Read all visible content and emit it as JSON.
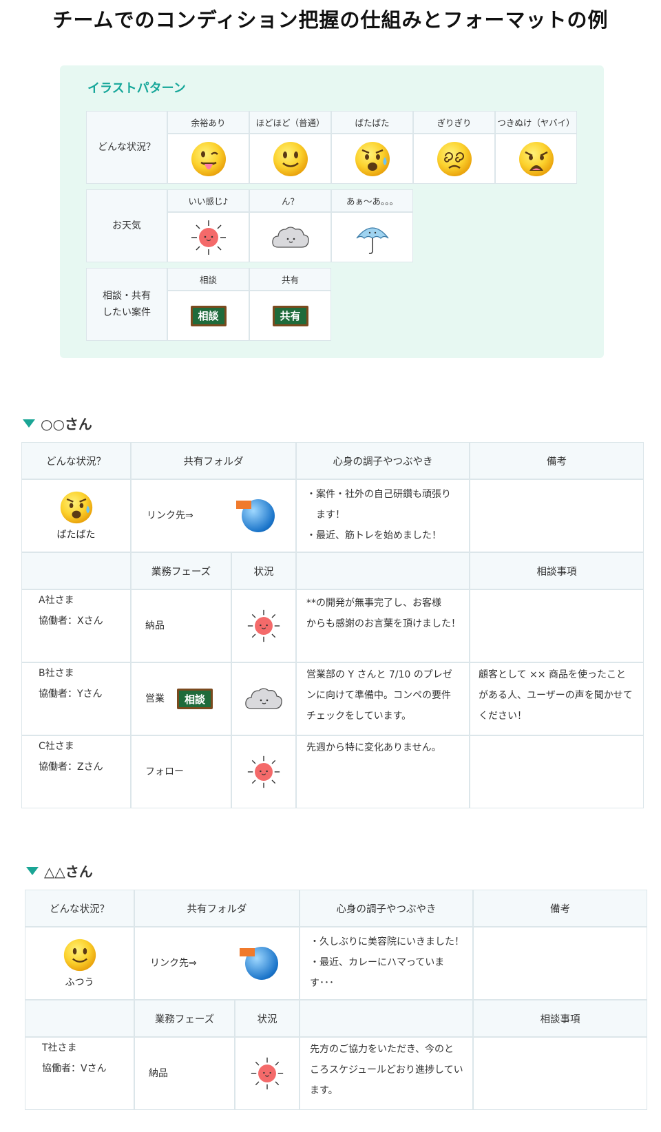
{
  "page_title": "チームでのコンディション把握の仕組みとフォーマットの例",
  "illust": {
    "title": "イラストパターン",
    "rows": [
      {
        "head": "どんな状況？",
        "labels": [
          "余裕あり",
          "ほどほど（普通）",
          "ばたばた",
          "ぎりぎり",
          "つきぬけ（ヤバイ）"
        ]
      },
      {
        "head": "お天気",
        "labels": [
          "いい感じ♪",
          "ん？",
          "あぁ～あ。。。"
        ]
      },
      {
        "head": "相談・共有\nしたい案件",
        "labels": [
          "相談",
          "共有"
        ]
      }
    ],
    "board_texts": [
      "相談",
      "共有"
    ]
  },
  "sections": [
    {
      "name": "○○さん",
      "headers": [
        "どんな状況？",
        "共有フォルダ",
        "心身の調子やつぶやき",
        "備考"
      ],
      "status_label": "ばたばた",
      "folder_text": "リンク先⇒",
      "tweets": [
        "・案件・社外の自己研鑽も頑張り",
        "ます！",
        "・最近、筋トレを始めました！"
      ],
      "sub_headers": [
        "業務フェーズ",
        "状況",
        "相談事項"
      ],
      "rows": [
        {
          "client": "A社さま",
          "partner": "協働者：Xさん",
          "phase": "納品",
          "weather": "sun",
          "board": "",
          "note": [
            "**の開発が無事完了し、お客様",
            "からも感謝のお言葉を頂けました！"
          ],
          "consult": []
        },
        {
          "client": "B社さま",
          "partner": "協働者：Yさん",
          "phase": "営業",
          "weather": "cloud",
          "board": "相談",
          "note": [
            "営業部の Y さんと 7/10 のプレゼ",
            "ンに向けて準備中。コンペの要件",
            "チェックをしています。"
          ],
          "consult": [
            "顧客として ×× 商品を使ったこと",
            "がある人、ユーザーの声を聞かせて",
            "ください！"
          ]
        },
        {
          "client": "C社さま",
          "partner": "協働者：Zさん",
          "phase": "フォロー",
          "weather": "sun",
          "board": "",
          "note": [
            "先週から特に変化ありません。"
          ],
          "consult": []
        }
      ]
    },
    {
      "name": "△△さん",
      "headers": [
        "どんな状況？",
        "共有フォルダ",
        "心身の調子やつぶやき",
        "備考"
      ],
      "status_label": "ふつう",
      "folder_text": "リンク先⇒",
      "tweets": [
        "・久しぶりに美容院にいきました！",
        "・最近、カレーにハマっています･･･"
      ],
      "sub_headers": [
        "業務フェーズ",
        "状況",
        "相談事項"
      ],
      "rows": [
        {
          "client": "T社さま",
          "partner": "協働者：Vさん",
          "phase": "納品",
          "weather": "sun",
          "board": "",
          "note": [
            "先方のご協力をいただき、今のと",
            "ころスケジュールどおり進捗してい",
            "ます。"
          ],
          "consult": []
        }
      ]
    }
  ],
  "colors": {
    "accent": "#17a79a",
    "panel_bg": "#e7f8f2",
    "header_bg": "#f4f9fb",
    "border": "#dce6ea"
  }
}
